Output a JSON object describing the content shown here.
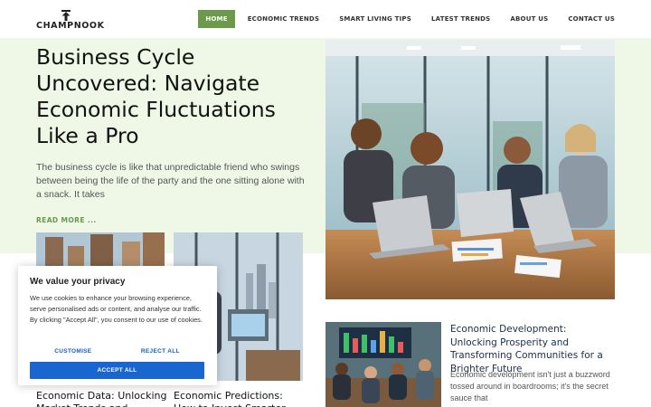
{
  "brand": {
    "name": "CHAMPNOOK",
    "logo_icon": "arrow-up-logo-icon"
  },
  "nav": [
    {
      "label": "HOME",
      "active": true
    },
    {
      "label": "ECONOMIC TRENDS",
      "active": false
    },
    {
      "label": "SMART LIVING TIPS",
      "active": false
    },
    {
      "label": "LATEST TRENDS",
      "active": false
    },
    {
      "label": "ABOUT US",
      "active": false
    },
    {
      "label": "CONTACT US",
      "active": false
    }
  ],
  "featured": {
    "title": "Business Cycle Uncovered: Navigate Economic Fluctuations Like a Pro",
    "excerpt": "The business cycle is like that unpredictable friend who swings between being the life of the party and the one sitting alone with a snack. It takes",
    "read_more": "READ MORE ..."
  },
  "grid": [
    {
      "title": "Economic Data: Unlocking Market Trends and..."
    },
    {
      "title": "Economic Predictions: How to Invest Smarter..."
    }
  ],
  "side_card": {
    "title": "Economic Development: Unlocking Prosperity and Transforming Communities for a Brighter Future",
    "excerpt": "Economic development isn't just a buzzword tossed around in boardrooms; it's the secret sauce that"
  },
  "cookie": {
    "title": "We value your privacy",
    "text": "We use cookies to enhance your browsing experience, serve personalised ads or content, and analyse our traffic. By clicking \"Accept All\", you consent to our use of cookies.",
    "customise": "CUSTOMISE",
    "reject": "REJECT ALL",
    "accept": "ACCEPT ALL"
  },
  "colors": {
    "accent_green": "#6a9a4a",
    "hero_band": "#eff8e6",
    "cookie_blue": "#1a66d0",
    "link_blue": "#1a5db4"
  }
}
